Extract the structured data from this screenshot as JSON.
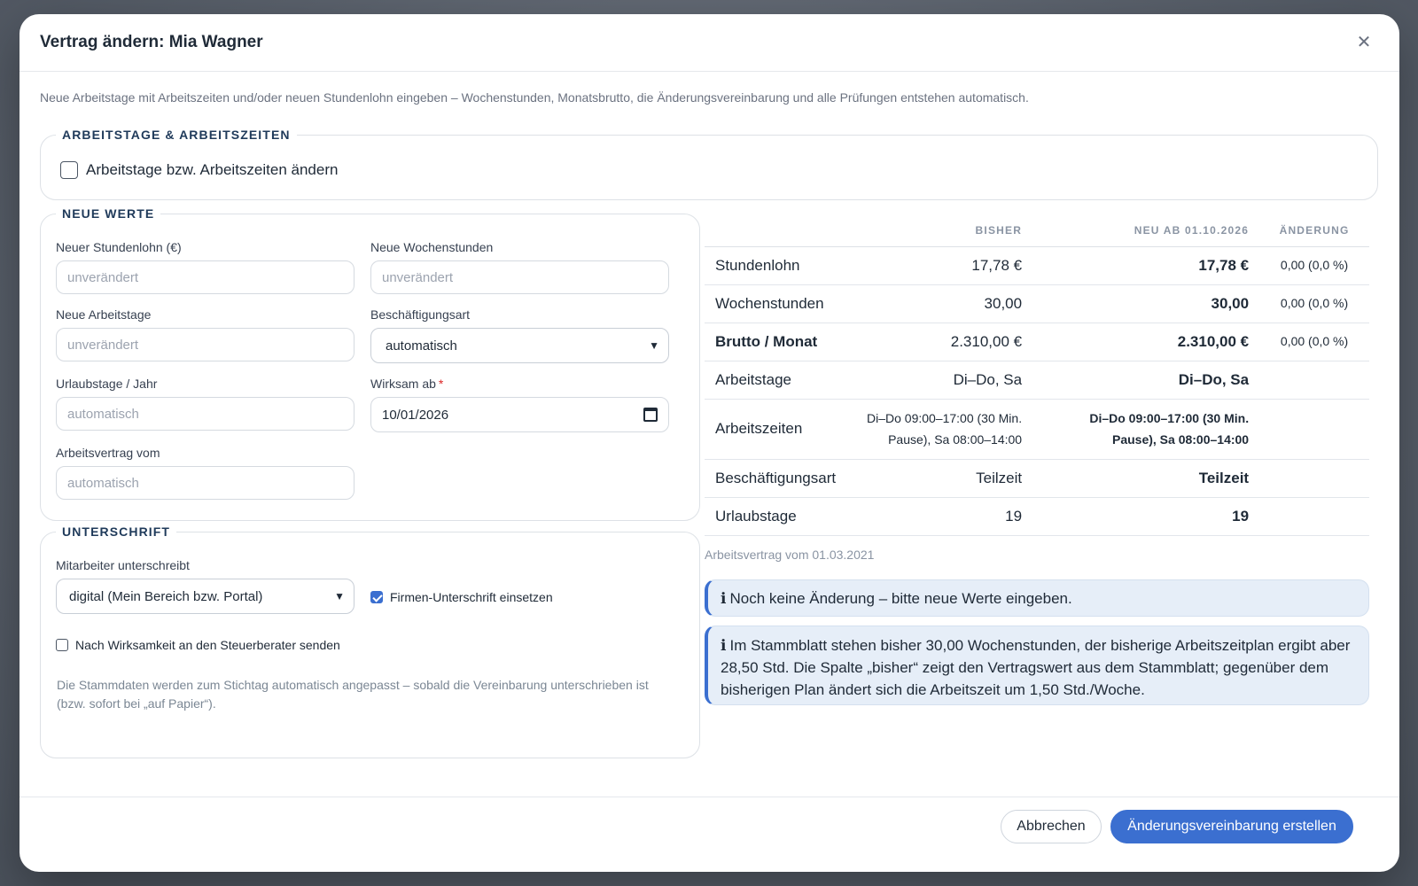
{
  "dialog": {
    "title": "Vertrag ändern: Mia Wagner",
    "intro": "Neue Arbeitstage mit Arbeitszeiten und/oder neuen Stundenlohn eingeben – Wochenstunden, Monatsbrutto, die Änderungsvereinbarung und alle Prüfungen entstehen automatisch."
  },
  "days_section": {
    "legend": "ARBEITSTAGE & ARBEITSZEITEN",
    "checkbox_label": "Arbeitstage bzw. Arbeitszeiten ändern",
    "checked": false
  },
  "values_section": {
    "legend": "NEUE WERTE",
    "hourly_wage": {
      "label": "Neuer Stundenlohn (€)",
      "placeholder": "unverändert"
    },
    "weekly_hours": {
      "label": "Neue Wochenstunden",
      "placeholder": "unverändert"
    },
    "work_days": {
      "label": "Neue Arbeitstage",
      "placeholder": "unverändert"
    },
    "employment_type": {
      "label": "Beschäftigungsart",
      "value": "automatisch"
    },
    "vacation_days": {
      "label": "Urlaubstage / Jahr",
      "placeholder": "automatisch"
    },
    "effective_from": {
      "label": "Wirksam ab",
      "required_mark": "*",
      "value": "10/01/2026"
    },
    "contract_date": {
      "label": "Arbeitsvertrag vom",
      "placeholder": "automatisch"
    }
  },
  "signature_section": {
    "legend": "UNTERSCHRIFT",
    "employee_signs_label": "Mitarbeiter unterschreibt",
    "employee_signs_value": "digital (Mein Bereich bzw. Portal)",
    "company_signature_label": "Firmen-Unterschrift einsetzen",
    "company_signature_checked": true,
    "tax_advisor_label": "Nach Wirksamkeit an den Steuerberater senden",
    "tax_advisor_checked": false,
    "note": "Die Stammdaten werden zum Stichtag automatisch angepasst – sobald die Vereinbarung unterschrieben ist (bzw. sofort bei „auf Papier“)."
  },
  "comparison": {
    "headers": {
      "label": "",
      "before": "BISHER",
      "new": "NEU AB 01.10.2026",
      "change": "ÄNDERUNG"
    },
    "rows": [
      {
        "label": "Stundenlohn",
        "before": "17,78 €",
        "new": "17,78 €",
        "change": "0,00 (0,0 %)"
      },
      {
        "label": "Wochenstunden",
        "before": "30,00",
        "new": "30,00",
        "change": "0,00 (0,0 %)"
      },
      {
        "label": "Brutto / Monat",
        "before": "2.310,00 €",
        "new": "2.310,00 €",
        "change": "0,00 (0,0 %)"
      },
      {
        "label": "Arbeitstage",
        "before": "Di–Do, Sa",
        "new": "Di–Do, Sa",
        "change": ""
      },
      {
        "label": "Arbeitszeiten",
        "before": "Di–Do 09:00–17:00 (30 Min. Pause), Sa 08:00–14:00",
        "new": "Di–Do 09:00–17:00 (30 Min. Pause), Sa 08:00–14:00",
        "change": ""
      },
      {
        "label": "Beschäftigungsart",
        "before": "Teilzeit",
        "new": "Teilzeit",
        "change": ""
      },
      {
        "label": "Urlaubstage",
        "before": "19",
        "new": "19",
        "change": ""
      }
    ],
    "contract_date_note": "Arbeitsvertrag vom 01.03.2021"
  },
  "alerts": {
    "icon": "ℹ",
    "no_change": "Noch keine Änderung – bitte neue Werte eingeben.",
    "stammblatt": "Im Stammblatt stehen bisher 30,00 Wochenstunden, der bisherige Arbeitszeitplan ergibt aber 28,50 Std. Die Spalte „bisher“ zeigt den Vertragswert aus dem Stammblatt; gegenüber dem bisherigen Plan ändert sich die Arbeitszeit um 1,50 Std./Woche."
  },
  "footer": {
    "cancel_label": "Abbrechen",
    "submit_label": "Änderungsvereinbarung erstellen"
  },
  "colors": {
    "accent": "#3b6fd0",
    "alert_bg": "#e6eef8",
    "required": "#dc2626"
  },
  "icons": {
    "close": "close-icon",
    "info": "info-icon",
    "calendar": "calendar-icon",
    "chevron": "chevron-down-icon"
  }
}
